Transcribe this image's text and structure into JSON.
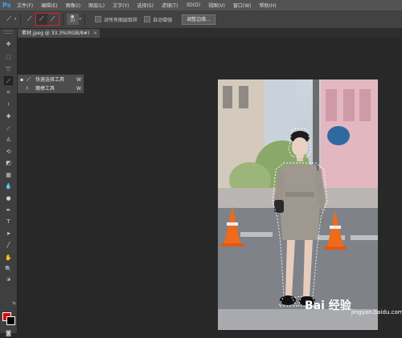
{
  "app": {
    "logo": "Ps"
  },
  "menu": [
    "文件(F)",
    "编辑(E)",
    "图像(I)",
    "图层(L)",
    "文字(Y)",
    "选择(S)",
    "滤镜(T)",
    "3D(D)",
    "视图(V)",
    "窗口(W)",
    "帮助(H)"
  ],
  "options": {
    "brush_size": "10",
    "sample_all_layers": "对所有图层取样",
    "auto_enhance": "自动增强",
    "refine_edge": "调整边缘..."
  },
  "document": {
    "tab_title": "素材.jpeg @ 33.3%(RGB/8#)",
    "close_glyph": "×"
  },
  "flyout": {
    "items": [
      {
        "label": "快速选择工具",
        "shortcut": "W",
        "icon": "quick-selection-icon",
        "active": true
      },
      {
        "label": "魔棒工具",
        "shortcut": "W",
        "icon": "magic-wand-icon",
        "active": false
      }
    ]
  },
  "colors": {
    "foreground": "#e10000",
    "background": "#000000",
    "highlight": "#e11f1f"
  },
  "watermark": {
    "logo": "Bai 经验",
    "sub": "jingyan.baidu.com"
  }
}
